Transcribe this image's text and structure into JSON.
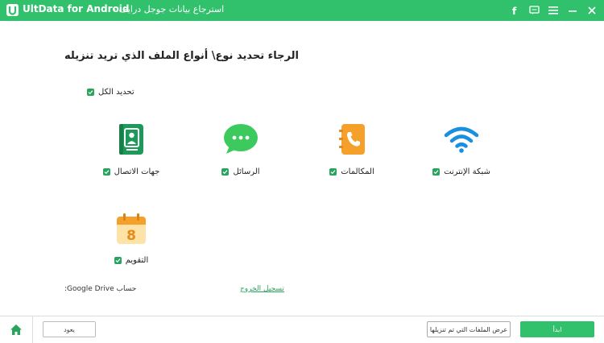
{
  "titlebar": {
    "app_name": "UltData for Android",
    "subtitle": "- استرجاع بيانات جوجل درايف",
    "icons": [
      "facebook-icon",
      "feedback-icon",
      "menu-icon",
      "minimize-icon",
      "close-icon"
    ]
  },
  "main": {
    "heading": "الرجاء تحديد نوع\\ أنواع الملف الذي تريد تنزيله",
    "select_all_label": "تحديد الكل",
    "file_types": [
      {
        "label": "شبكة الإنترنت",
        "icon": "wifi-icon",
        "checked": true
      },
      {
        "label": "المكالمات",
        "icon": "call-log-icon",
        "checked": true
      },
      {
        "label": "الرسائل",
        "icon": "messages-icon",
        "checked": true
      },
      {
        "label": "جهات الاتصال",
        "icon": "contacts-icon",
        "checked": true
      },
      {
        "label": "التقويم",
        "icon": "calendar-icon",
        "checked": true
      }
    ],
    "calendar_day": "8",
    "google_drive_account": "حساب Google Drive:",
    "logout_label": "تسجيل الخروج"
  },
  "footer": {
    "back_label": "يعود",
    "view_downloaded_label": "عرض الملفات التي تم تنزيلها",
    "start_label": "ابدأ"
  },
  "colors": {
    "accent": "#31c06b",
    "checkbox": "#2aa35e",
    "icon_orange": "#f5a02b",
    "wifi_blue": "#1a8fe0"
  }
}
